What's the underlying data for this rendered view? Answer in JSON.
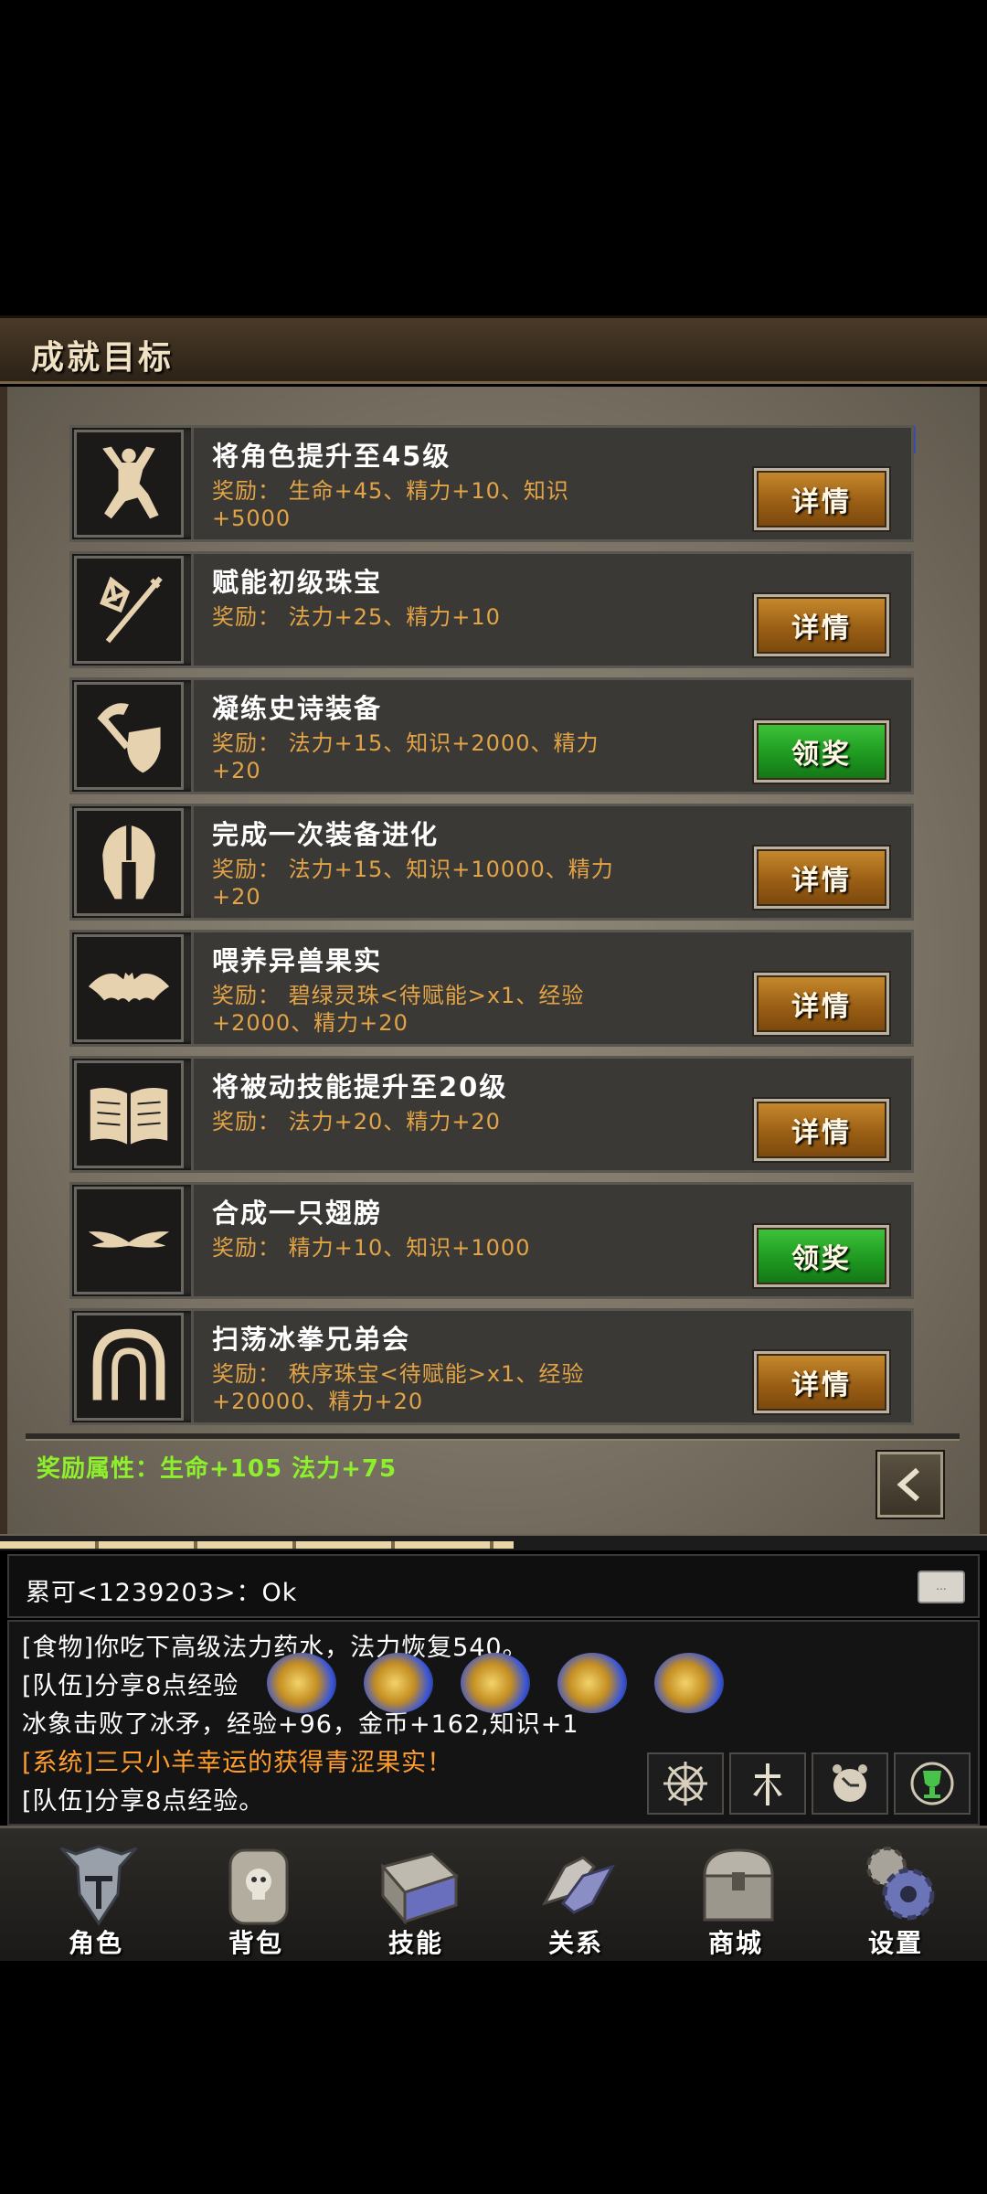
{
  "header": {
    "title": "成就目标"
  },
  "achievements": [
    {
      "title": "将角色提升至45级",
      "reward": "奖励： 生命+45、精力+10、知识+5000",
      "button": "详情",
      "state": "detail",
      "icon": "kneeling-figure-icon"
    },
    {
      "title": "赋能初级珠宝",
      "reward": "奖励： 法力+25、精力+10",
      "button": "详情",
      "state": "detail",
      "icon": "gem-sword-icon"
    },
    {
      "title": "凝练史诗装备",
      "reward": "奖励： 法力+15、知识+2000、精力+20",
      "button": "领奖",
      "state": "claim",
      "icon": "axe-shield-icon"
    },
    {
      "title": "完成一次装备进化",
      "reward": "奖励： 法力+15、知识+10000、精力+20",
      "button": "详情",
      "state": "detail",
      "icon": "helmet-icon"
    },
    {
      "title": "喂养异兽果实",
      "reward": "奖励： 碧绿灵珠<待赋能>x1、经验+2000、精力+20",
      "button": "详情",
      "state": "detail",
      "icon": "bat-icon"
    },
    {
      "title": "将被动技能提升至20级",
      "reward": "奖励： 法力+20、精力+20",
      "button": "详情",
      "state": "detail",
      "icon": "book-icon"
    },
    {
      "title": "合成一只翅膀",
      "reward": "奖励： 精力+10、知识+1000",
      "button": "领奖",
      "state": "claim",
      "icon": "wings-icon"
    },
    {
      "title": "扫荡冰拳兄弟会",
      "reward": "奖励： 秩序珠宝<待赋能>x1、经验+20000、精力+20",
      "button": "详情",
      "state": "detail",
      "icon": "arch-icon"
    }
  ],
  "bonus_text": "奖励属性：生命+105 法力+75",
  "chat": {
    "input_line": "累可<1239203>：Ok",
    "log": [
      {
        "text": "[食物]你吃下高级法力药水，法力恢复540。",
        "type": "normal"
      },
      {
        "text": "[队伍]分享8点经验",
        "type": "normal"
      },
      {
        "text": "冰象击败了冰矛，经验+96，金币+162,知识+1",
        "type": "normal"
      },
      {
        "text": "[系统]三只小羊幸运的获得青涩果实！",
        "type": "system"
      },
      {
        "text": "[队伍]分享8点经验。",
        "type": "normal"
      }
    ],
    "keyboard_label": "..."
  },
  "tools": [
    "compass-icon",
    "sword-icon",
    "clock-icon",
    "trophy-icon"
  ],
  "nav": [
    {
      "label": "角色",
      "icon": "knight-helmet-icon"
    },
    {
      "label": "背包",
      "icon": "backpack-icon"
    },
    {
      "label": "技能",
      "icon": "spellbook-icon"
    },
    {
      "label": "关系",
      "icon": "handshake-icon"
    },
    {
      "label": "商城",
      "icon": "treasure-chest-icon"
    },
    {
      "label": "设置",
      "icon": "gear-icon"
    }
  ],
  "colors": {
    "reward_text": "#e3a447",
    "bonus_text": "#8ef02c",
    "system_text": "#ff9d2e",
    "detail_button": "#9a5f15",
    "claim_button": "#1f9a21"
  },
  "exp_progress": 0.52
}
